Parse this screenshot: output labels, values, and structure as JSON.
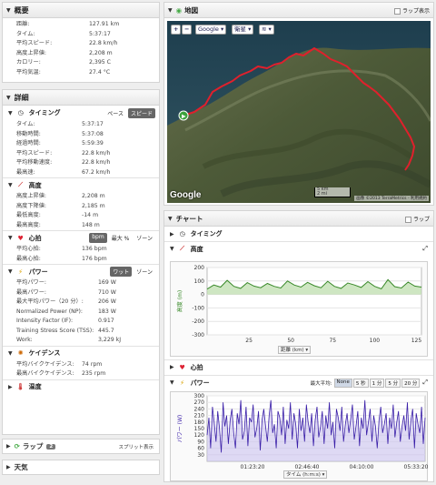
{
  "summary": {
    "title": "概要",
    "rows": [
      {
        "k": "距離:",
        "v": "127.91 km"
      },
      {
        "k": "タイム:",
        "v": "5:37:17"
      },
      {
        "k": "平均スピード:",
        "v": "22.8 km/h"
      },
      {
        "k": "高度上昇値:",
        "v": "2,208 m"
      },
      {
        "k": "カロリー:",
        "v": "2,395 C"
      },
      {
        "k": "平均気温:",
        "v": "27.4 °C"
      }
    ]
  },
  "details": {
    "title": "詳細",
    "timing": {
      "title": "タイミング",
      "toggle": [
        "ペース",
        "スピード"
      ],
      "rows": [
        {
          "k": "タイム:",
          "v": "5:37:17"
        },
        {
          "k": "移動時間:",
          "v": "5:37:08"
        },
        {
          "k": "経過時間:",
          "v": "5:59:39"
        },
        {
          "k": "平均スピード:",
          "v": "22.8 km/h"
        },
        {
          "k": "平均移動速度:",
          "v": "22.8 km/h"
        },
        {
          "k": "最高速:",
          "v": "67.2 km/h"
        }
      ]
    },
    "elevation": {
      "title": "高度",
      "rows": [
        {
          "k": "高度上昇値:",
          "v": "2,208 m"
        },
        {
          "k": "高度下降値:",
          "v": "2,185 m"
        },
        {
          "k": "最低高度:",
          "v": "-14 m"
        },
        {
          "k": "最高高度:",
          "v": "148 m"
        }
      ]
    },
    "hr": {
      "title": "心拍",
      "toggle": [
        "bpm",
        "最大 %",
        "ゾーン"
      ],
      "rows": [
        {
          "k": "平均心拍:",
          "v": "136 bpm"
        },
        {
          "k": "最高心拍:",
          "v": "176 bpm"
        }
      ]
    },
    "power": {
      "title": "パワー",
      "toggle": [
        "ワット",
        "ゾーン"
      ],
      "rows": [
        {
          "k": "平均パワー:",
          "v": "169 W"
        },
        {
          "k": "最高パワー:",
          "v": "710 W"
        },
        {
          "k": "最大平均パワー（20 分）:",
          "v": "206 W"
        },
        {
          "k": "Normalized Power (NP):",
          "v": "183 W"
        },
        {
          "k": "Intensity Factor (IF):",
          "v": "0.917"
        },
        {
          "k": "Training Stress Score (TSS):",
          "v": "445.7"
        },
        {
          "k": "Work:",
          "v": "3,229 kJ"
        }
      ]
    },
    "cadence": {
      "title": "ケイデンス",
      "rows": [
        {
          "k": "平均バイクケイデンス:",
          "v": "74 rpm"
        },
        {
          "k": "最高バイクケイデンス:",
          "v": "235 rpm"
        }
      ]
    },
    "temp": {
      "title": "温度"
    }
  },
  "laps": {
    "title": "ラップ",
    "count": "2",
    "split": "スプリット表示"
  },
  "weather": {
    "title": "天気"
  },
  "map": {
    "title": "地図",
    "lap_display": "ラップ表示",
    "provider": "Google",
    "maptype": "衛星",
    "scale_km": "5 km",
    "scale_mi": "2 mi",
    "copyright": "画像 ©2013 TerraMetrics - 利用規約",
    "logo": "Google",
    "route_color": "#e0202c"
  },
  "chart": {
    "title": "チャート",
    "lap_display": "ラップ",
    "timing": "タイミング",
    "elevation_title": "高度",
    "hr_title": "心拍",
    "power_title": "パワー",
    "smoothing_label": "最大平均:",
    "smoothing": [
      "None",
      "5 秒",
      "1 分",
      "5 分",
      "20 分"
    ],
    "selected_smoothing": "None",
    "elev_xlabel": "距離 (km)",
    "power_xlabel": "タイム (h:m:s)"
  },
  "chart_data": [
    {
      "type": "area",
      "title": "高度",
      "ylabel": "高度 (m)",
      "xlabel": "距離 (km)",
      "ylim": [
        -300,
        200
      ],
      "yticks": [
        200,
        100,
        0,
        -100,
        -200,
        -300
      ],
      "xticks": [
        25,
        50,
        75,
        100,
        125
      ],
      "xlim": [
        0,
        128
      ],
      "color": "#3a8a2a",
      "x": [
        0,
        4,
        8,
        12,
        16,
        20,
        24,
        28,
        32,
        36,
        40,
        44,
        48,
        52,
        56,
        60,
        64,
        68,
        72,
        76,
        80,
        84,
        88,
        92,
        96,
        100,
        104,
        108,
        112,
        116,
        120,
        124,
        128
      ],
      "y": [
        40,
        70,
        55,
        105,
        60,
        45,
        88,
        62,
        50,
        82,
        60,
        48,
        100,
        70,
        55,
        90,
        65,
        50,
        98,
        60,
        45,
        85,
        70,
        52,
        95,
        60,
        42,
        110,
        58,
        48,
        92,
        62,
        55
      ]
    },
    {
      "type": "area",
      "title": "パワー",
      "ylabel": "パワー (W)",
      "xlabel": "タイム (h:m:s)",
      "ylim": [
        0,
        300
      ],
      "yticks": [
        300,
        270,
        240,
        210,
        180,
        150,
        120,
        90,
        60,
        30
      ],
      "xticks": [
        "01:23:20",
        "02:46:40",
        "04:10:00",
        "05:33:20"
      ],
      "color": "#3a1fa8",
      "y": [
        120,
        200,
        60,
        250,
        180,
        90,
        230,
        150,
        40,
        270,
        160,
        210,
        80,
        190,
        240,
        130,
        60,
        220,
        170,
        280,
        100,
        140,
        250,
        70,
        200,
        180,
        260,
        110,
        150,
        230,
        50,
        190,
        240,
        160,
        90,
        210,
        280,
        130,
        170,
        60,
        230,
        200,
        120,
        250,
        80,
        190,
        150,
        270,
        100,
        220,
        170,
        60,
        240,
        140,
        200,
        90,
        260,
        180,
        130,
        220,
        70,
        190,
        250,
        110,
        160,
        230,
        80,
        210,
        150,
        270,
        120,
        180,
        60,
        240,
        200,
        140,
        250,
        90,
        170,
        220,
        130,
        190,
        260,
        100,
        160,
        230,
        70,
        200,
        150,
        280,
        120,
        180,
        240,
        90,
        210,
        160,
        60,
        190,
        250,
        130,
        170,
        220,
        80,
        200,
        150,
        260,
        110,
        180,
        230,
        90,
        160,
        210,
        140,
        270,
        100,
        190,
        240,
        60,
        220,
        170,
        130,
        250,
        80,
        200
      ]
    }
  ]
}
